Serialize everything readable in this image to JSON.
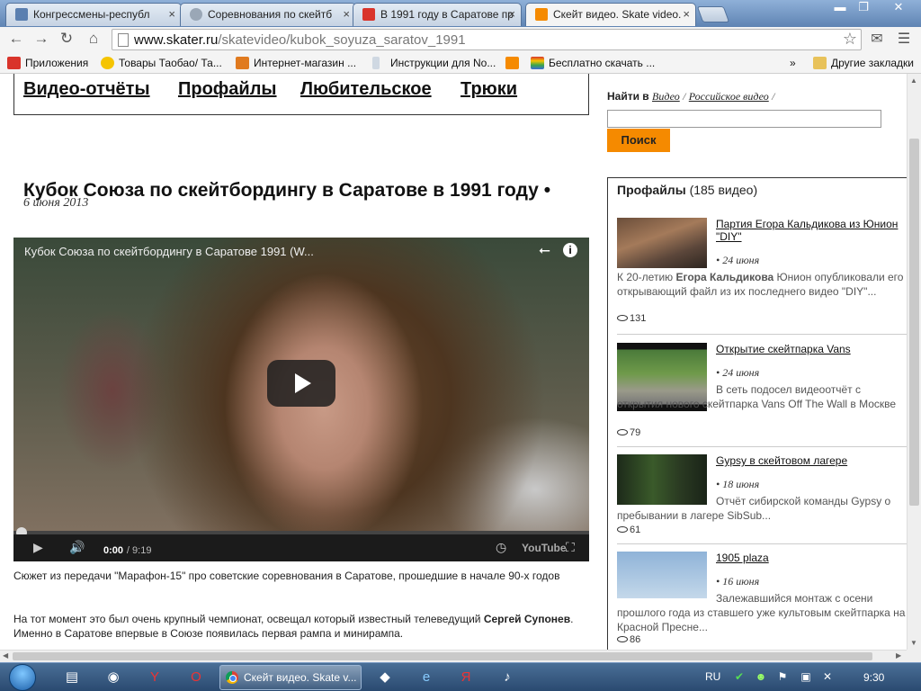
{
  "tabs": [
    {
      "title": "Конгрессмены-республ",
      "color": "#5a7fb0"
    },
    {
      "title": "Соревнования по скейтб",
      "color": "#9aa7b6"
    },
    {
      "title": "В 1991 году в Саратове пр",
      "color": "#d9342b"
    },
    {
      "title": "Скейт видео. Skate video.",
      "color": "#f58a00"
    }
  ],
  "window": {
    "minimize": "▬",
    "maximize": "❐",
    "close": "✕"
  },
  "toolbar": {
    "back": "←",
    "forward": "→",
    "reload": "↻",
    "home": "⌂",
    "url_host": "www.skater.ru",
    "url_path": "/skatevideo/kubok_soyuza_saratov_1991",
    "star": "☆",
    "mail": "✉",
    "menu": "☰"
  },
  "bookmarks": {
    "items": [
      {
        "label": "Приложения",
        "color": "#d9342b"
      },
      {
        "label": "Товары Таобао/ Та...",
        "color": "#f5c400"
      },
      {
        "label": "Интернет-магазин ...",
        "color": "#e07a1f"
      },
      {
        "label": "Инструкции для No...",
        "color": "#cfd8e2"
      },
      {
        "label": "",
        "color": "#f58a00"
      },
      {
        "label": "Бесплатно скачать ...",
        "color": "#3aa64a"
      }
    ],
    "more": "»",
    "other": "Другие закладки"
  },
  "topnav": [
    "Видео-отчёты",
    "Профайлы",
    "Любительское",
    "Трюки"
  ],
  "article": {
    "title": "Кубок Союза по скейтбордингу в Саратове в 1991 году",
    "bullet": "•",
    "date": "6 июня 2013",
    "paragraph1": "Сюжет из передачи \"Марафон-15\" про советские соревнования в Саратове, прошедшие в начале 90-х годов",
    "p2_part1": "На тот момент это был очень крупный чемпионат, освещал который известный телеведущий ",
    "p2_bold": "Сергей Супонев",
    "p2_part2": ". Именно в Саратове впервые в Союзе появилась первая рампа и минирампа."
  },
  "player": {
    "title": "Кубок Союза по скейтбордингу в Саратове 1991 (W...",
    "time_current": "0:00",
    "time_total": "/ 9:19",
    "logo": "YouTube",
    "progress": 0
  },
  "search": {
    "label": "Найти в",
    "link1": "Видео",
    "sep": "/",
    "link2": "Российское видео",
    "button": "Поиск",
    "value": ""
  },
  "profiles": {
    "heading": "Профайлы",
    "count": "(185 видео)",
    "items": [
      {
        "title": "Партия Егора Кальдикова из Юнион \"DIY\"",
        "date": "• 24 июня",
        "desc_a": "К 20-летию ",
        "desc_b": "Егора Кальдикова",
        "desc_c": " Юнион опубликовали его открывающий файл из их последнего видео \"DIY\"...",
        "views": "131"
      },
      {
        "title": "Открытие скейтпарка Vans",
        "date": "• 24 июня",
        "desc": "В сеть подосел видеоотчёт с открытия нового скейтпарка Vans Off The Wall в Москве",
        "views": "79"
      },
      {
        "title": "Gypsy в скейтовом лагере",
        "date": "• 18 июня",
        "desc": "Отчёт сибирской команды Gypsy о пребывании в лагере SibSub...",
        "views": "61"
      },
      {
        "title": "1905 plaza",
        "date": "• 16 июня",
        "desc": "Залежавшийся монтаж с осени прошлого года из ставшего уже культовым скейтпарка на Красной Пресне...",
        "views": "86"
      }
    ]
  },
  "taskbar": {
    "chrome_label": "Скейт видео. Skate v...",
    "lang": "RU",
    "clock": "9:30"
  }
}
